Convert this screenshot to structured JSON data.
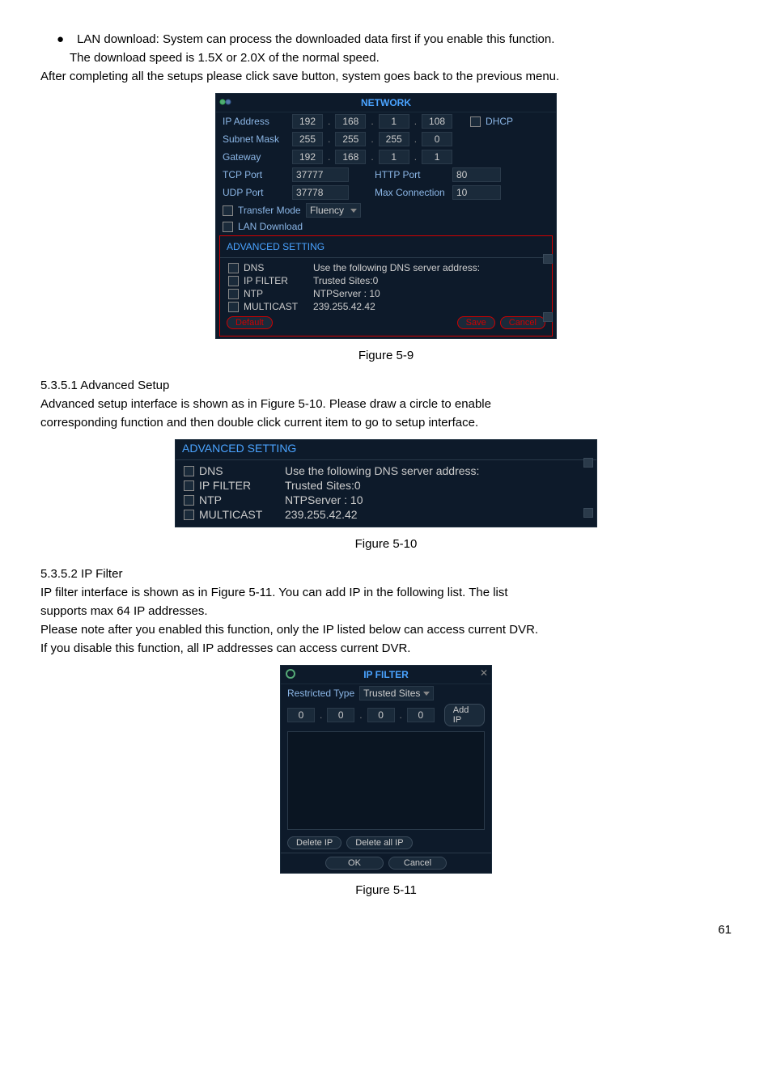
{
  "body": {
    "bullet1_line1": "LAN download: System can process the downloaded data first if you enable this function.",
    "bullet1_line2": "The download speed is 1.5X or 2.0X of the normal speed.",
    "after_setups": "After completing all the setups please click save button, system goes back to the previous menu.",
    "fig59": "Figure 5-9",
    "h5351": "5.3.5.1  Advanced Setup",
    "adv_p1": "Advanced setup interface is shown as in Figure 5-10. Please draw a circle to enable",
    "adv_p2": "corresponding function and then double click current item to go to setup interface.",
    "fig510": "Figure 5-10",
    "h5352": "5.3.5.2  IP Filter",
    "ipf_p1": "IP filter interface is shown as in Figure 5-11. You can add IP in the following list.  The list",
    "ipf_p2": "supports max 64 IP addresses.",
    "ipf_p3": "Please note after you enabled this function, only the IP listed below can access current DVR.",
    "ipf_p4": "If you disable this function, all IP addresses can access current DVR.",
    "fig511": "Figure 5-11",
    "page": "61"
  },
  "network": {
    "title": "NETWORK",
    "labels": {
      "ip": "IP Address",
      "mask": "Subnet Mask",
      "gateway": "Gateway",
      "tcp": "TCP Port",
      "udp": "UDP Port",
      "transfer": "Transfer Mode",
      "lan": "LAN Download",
      "http": "HTTP Port",
      "maxconn": "Max Connection"
    },
    "ip": [
      "192",
      "168",
      "1",
      "108"
    ],
    "mask": [
      "255",
      "255",
      "255",
      "0"
    ],
    "gateway": [
      "192",
      "168",
      "1",
      "1"
    ],
    "tcp": "37777",
    "http": "80",
    "udp": "37778",
    "maxconn": "10",
    "transfer_mode": "Fluency",
    "dhcp": "DHCP",
    "adv_heading": "ADVANCED SETTING",
    "adv": {
      "dns_l": "DNS",
      "dns_r": "Use the following DNS server address:",
      "ipf_l": "IP FILTER",
      "ipf_r": "Trusted Sites:0",
      "ntp_l": "NTP",
      "ntp_r": "NTPServer : 10",
      "mc_l": "MULTICAST",
      "mc_r": "239.255.42.42"
    },
    "buttons": {
      "default": "Default",
      "save": "Save",
      "cancel": "Cancel"
    }
  },
  "adv_panel": {
    "heading": "ADVANCED SETTING",
    "dns_l": "DNS",
    "dns_r": "Use the following DNS server address:",
    "ipf_l": "IP FILTER",
    "ipf_r": "Trusted Sites:0",
    "ntp_l": "NTP",
    "ntp_r": "NTPServer : 10",
    "mc_l": "MULTICAST",
    "mc_r": "239.255.42.42"
  },
  "ipfilter": {
    "title": "IP FILTER",
    "restricted": "Restricted Type",
    "trusted": "Trusted Sites",
    "ip": [
      "0",
      "0",
      "0",
      "0"
    ],
    "add": "Add IP",
    "delete": "Delete IP",
    "delete_all": "Delete all IP",
    "ok": "OK",
    "cancel": "Cancel"
  }
}
